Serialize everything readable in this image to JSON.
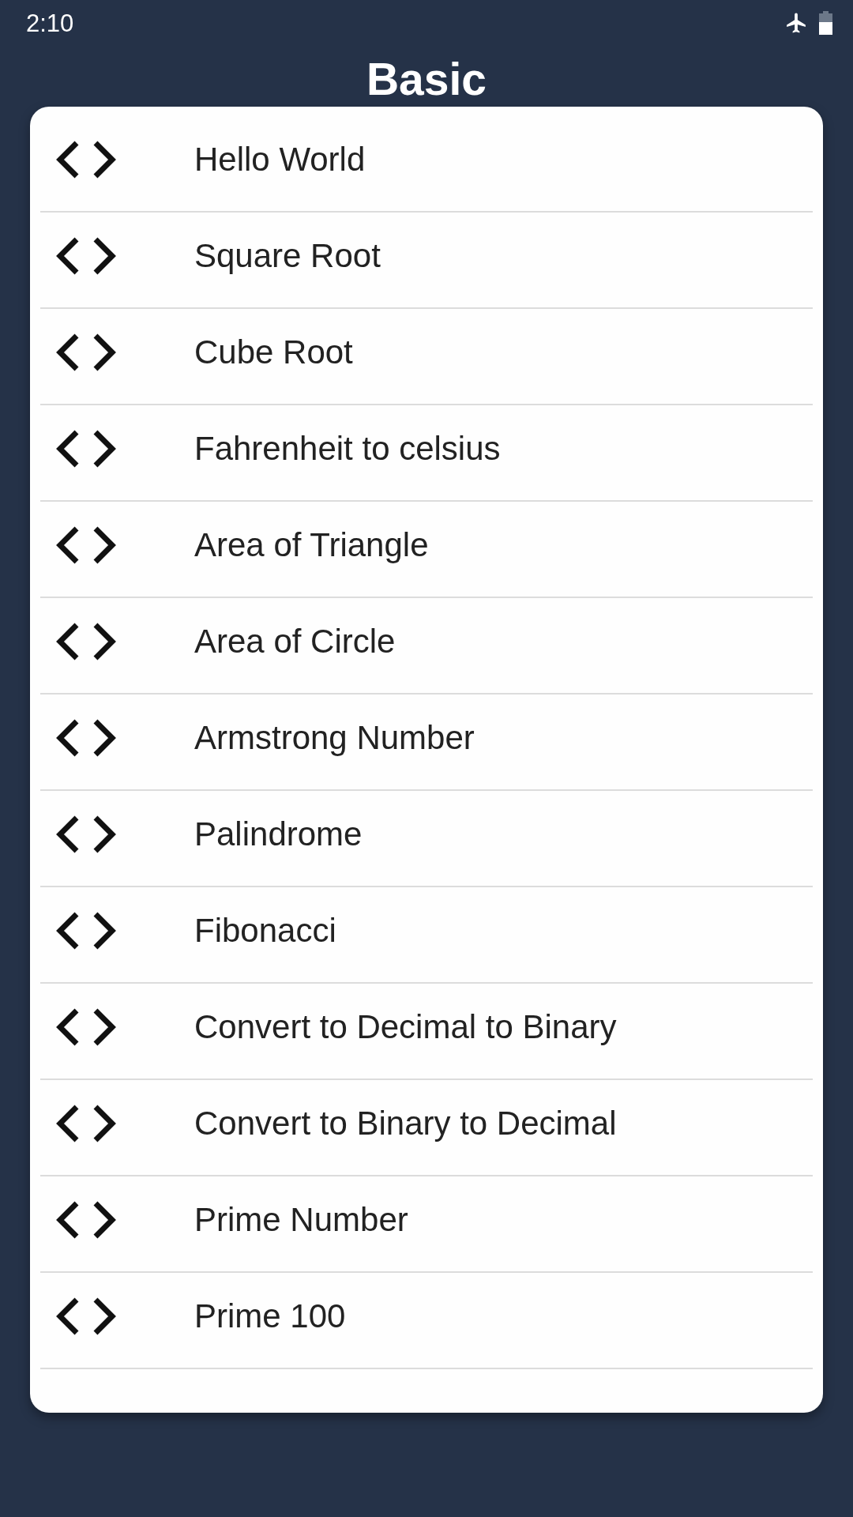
{
  "status_bar": {
    "time": "2:10"
  },
  "title": "Basic",
  "items": [
    {
      "label": "Hello World"
    },
    {
      "label": "Square Root"
    },
    {
      "label": "Cube Root"
    },
    {
      "label": "Fahrenheit to celsius"
    },
    {
      "label": "Area of Triangle"
    },
    {
      "label": "Area of Circle"
    },
    {
      "label": "Armstrong Number"
    },
    {
      "label": "Palindrome"
    },
    {
      "label": "Fibonacci"
    },
    {
      "label": "Convert to Decimal to Binary"
    },
    {
      "label": "Convert to Binary to Decimal"
    },
    {
      "label": "Prime Number"
    },
    {
      "label": "Prime 100"
    }
  ]
}
